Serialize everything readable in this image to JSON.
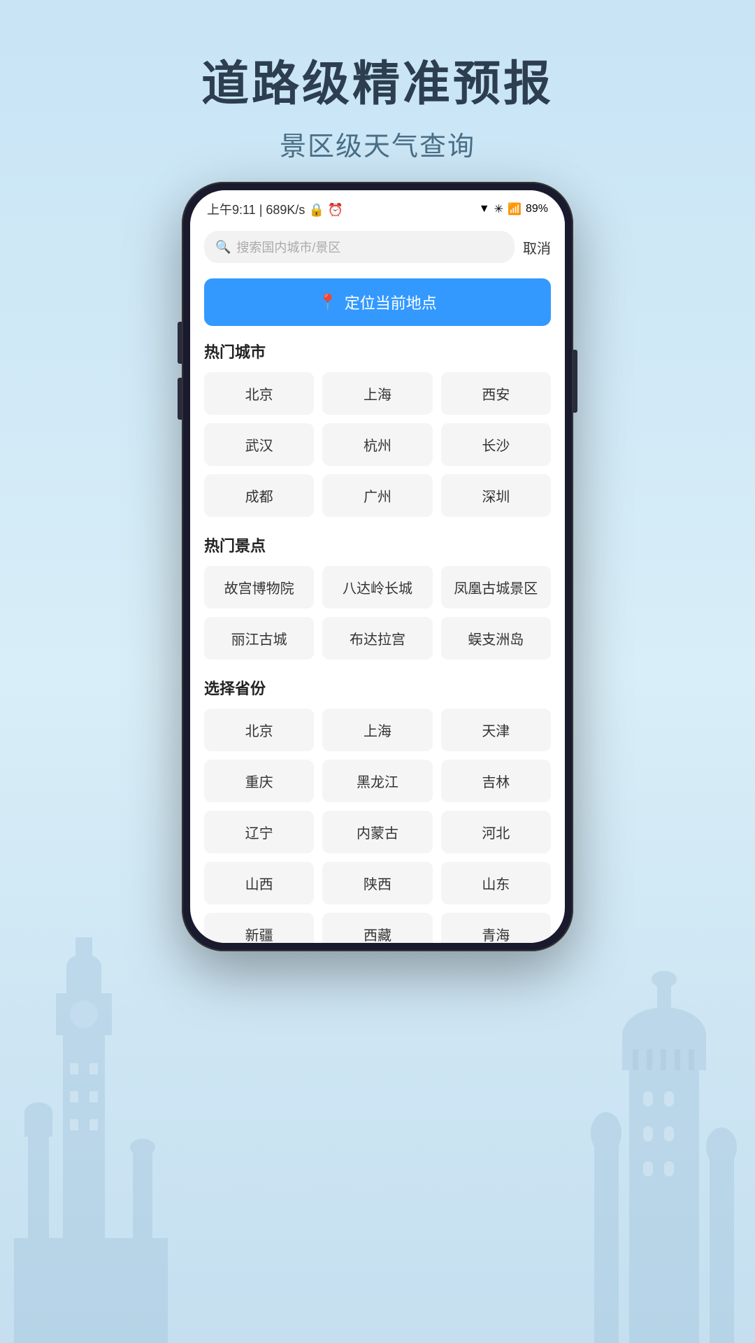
{
  "page": {
    "background_color": "#c8e4f5"
  },
  "header": {
    "main_title": "道路级精准预报",
    "sub_title": "景区级天气查询"
  },
  "status_bar": {
    "time": "上午9:11",
    "network": "689K/s",
    "battery": "89"
  },
  "search": {
    "placeholder": "搜索国内城市/景区",
    "cancel_label": "取消"
  },
  "locate_button": {
    "label": "定位当前地点"
  },
  "hot_cities": {
    "section_title": "热门城市",
    "cities": [
      {
        "name": "北京"
      },
      {
        "name": "上海"
      },
      {
        "name": "西安"
      },
      {
        "name": "武汉"
      },
      {
        "name": "杭州"
      },
      {
        "name": "长沙"
      },
      {
        "name": "成都"
      },
      {
        "name": "广州"
      },
      {
        "name": "深圳"
      }
    ]
  },
  "hot_scenic": {
    "section_title": "热门景点",
    "spots": [
      {
        "name": "故宫博物院"
      },
      {
        "name": "八达岭长城"
      },
      {
        "name": "凤凰古城景区"
      },
      {
        "name": "丽江古城"
      },
      {
        "name": "布达拉宫"
      },
      {
        "name": "蜈支洲岛"
      }
    ]
  },
  "provinces": {
    "section_title": "选择省份",
    "list": [
      {
        "name": "北京"
      },
      {
        "name": "上海"
      },
      {
        "name": "天津"
      },
      {
        "name": "重庆"
      },
      {
        "name": "黑龙江"
      },
      {
        "name": "吉林"
      },
      {
        "name": "辽宁"
      },
      {
        "name": "内蒙古"
      },
      {
        "name": "河北"
      },
      {
        "name": "山西"
      },
      {
        "name": "陕西"
      },
      {
        "name": "山东"
      },
      {
        "name": "新疆"
      },
      {
        "name": "西藏"
      },
      {
        "name": "青海"
      }
    ]
  }
}
